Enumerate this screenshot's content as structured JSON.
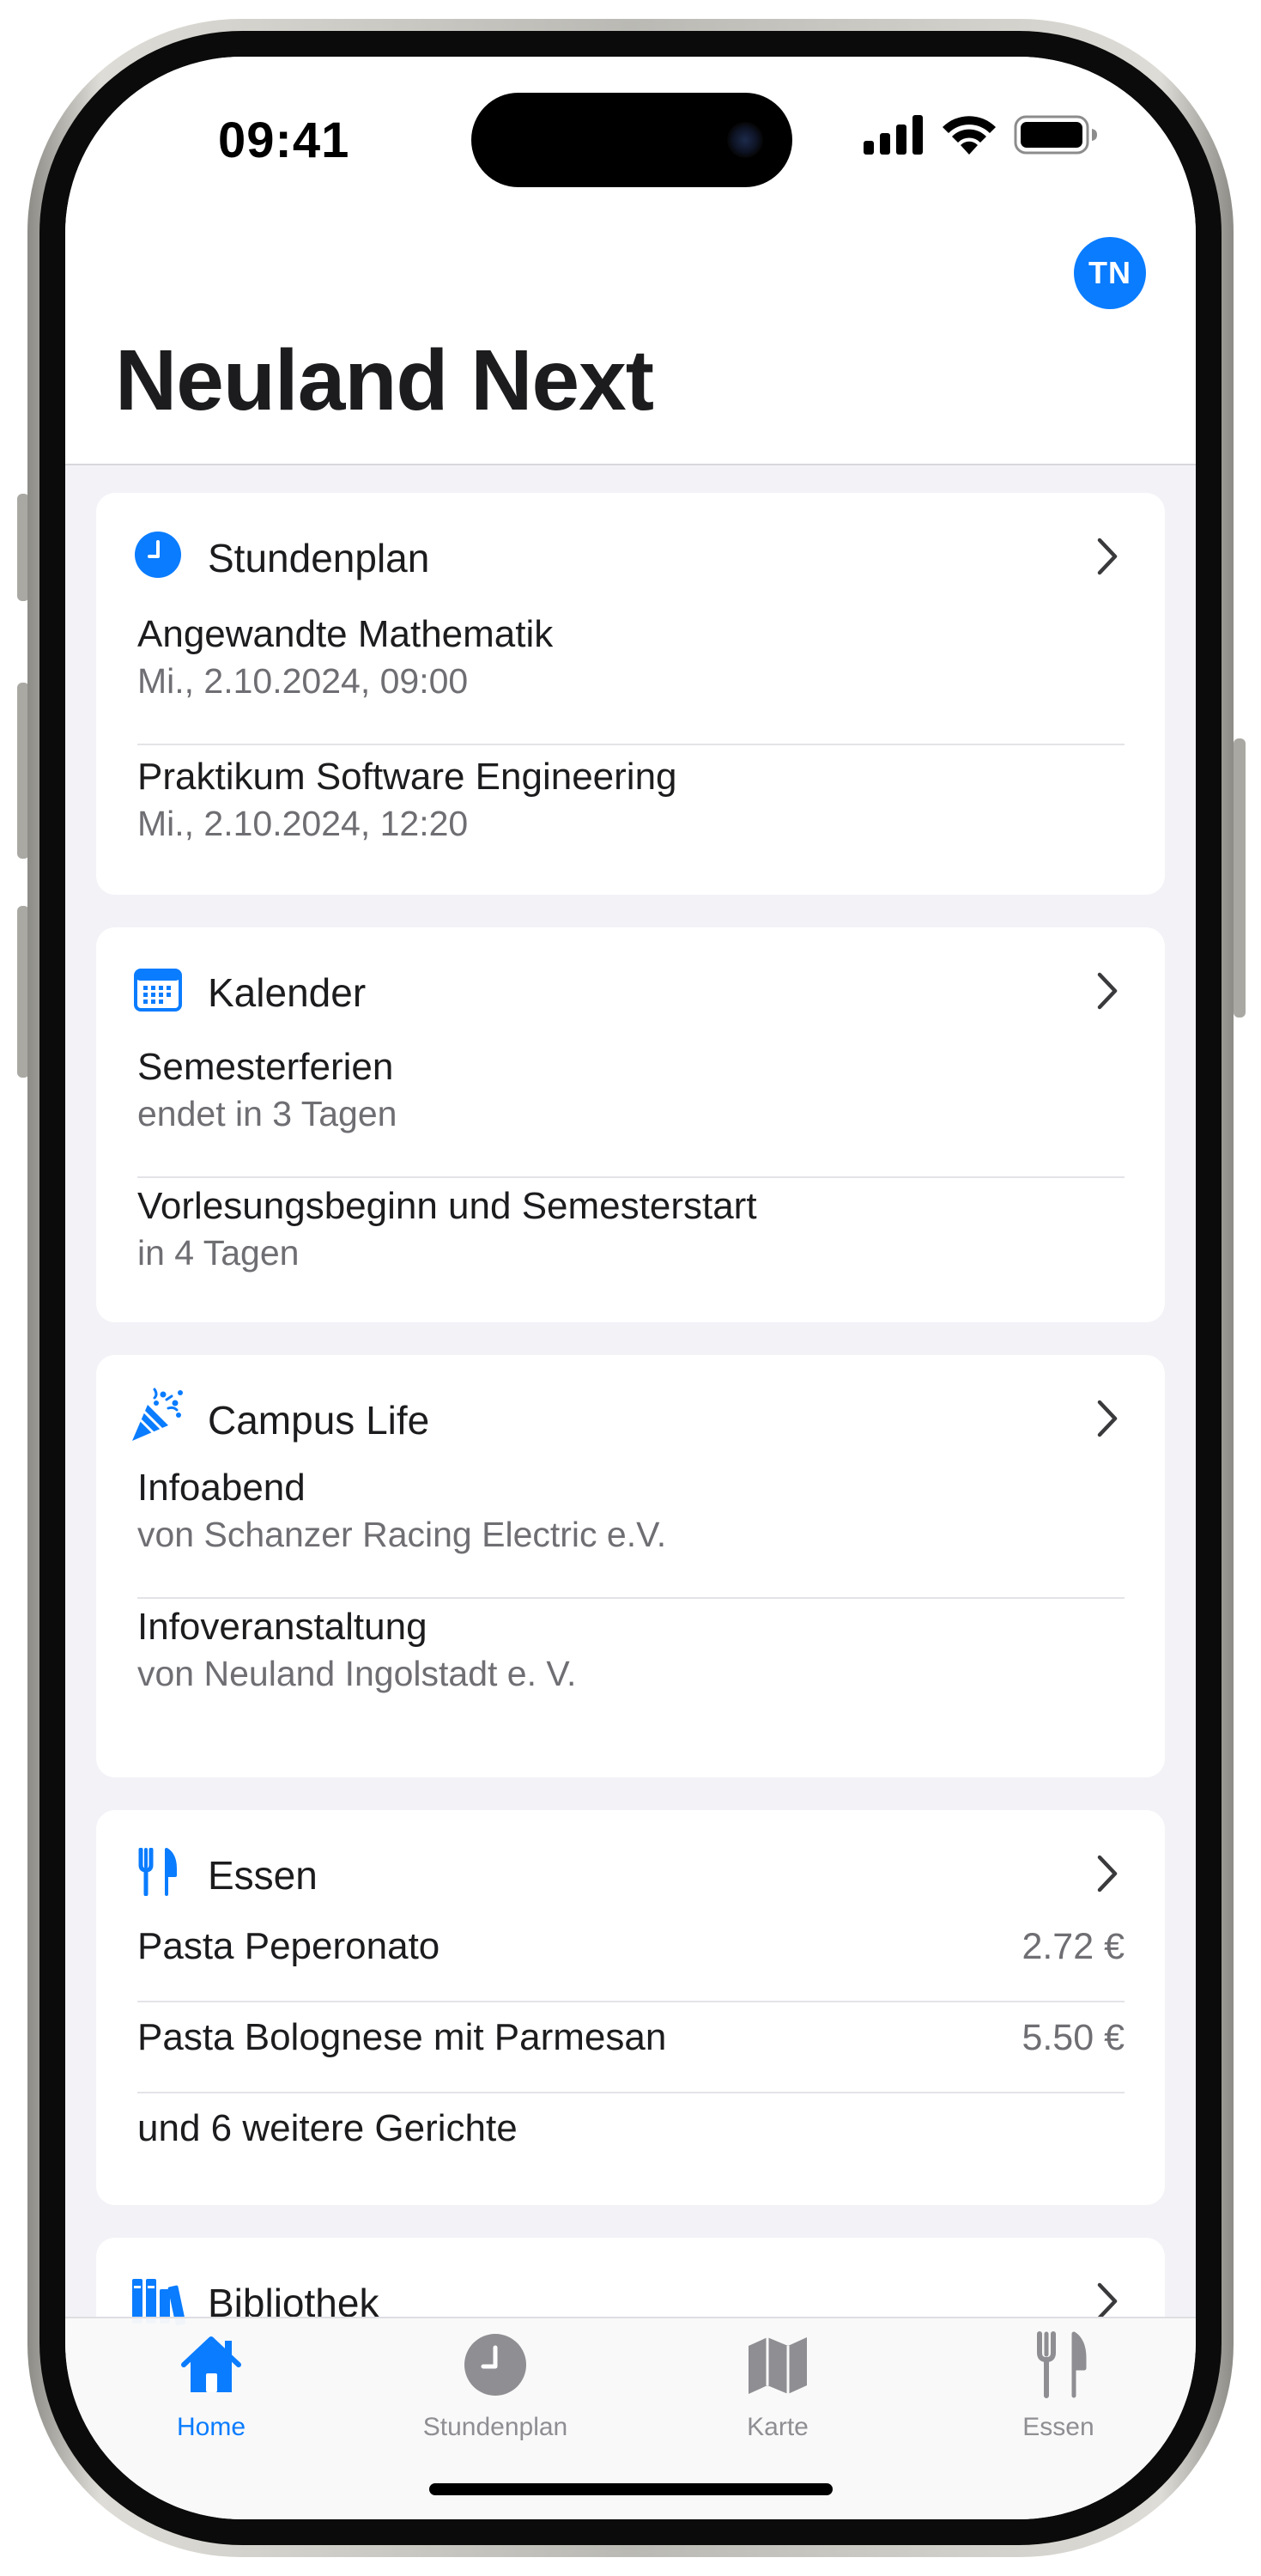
{
  "status_bar": {
    "time": "09:41",
    "icons": [
      "cellular-signal-icon",
      "wifi-icon",
      "battery-icon"
    ]
  },
  "header": {
    "avatar_initials": "TN",
    "title": "Neuland Next"
  },
  "colors": {
    "accent": "#0a7cff",
    "text_primary": "#1c1c1e",
    "text_secondary": "#6e6e73",
    "background": "#f2f2f7"
  },
  "cards": {
    "timetable": {
      "icon": "clock-icon",
      "title": "Stundenplan",
      "items": [
        {
          "title": "Angewandte Mathematik",
          "subtitle": "Mi., 2.10.2024, 09:00"
        },
        {
          "title": "Praktikum Software Engineering",
          "subtitle": "Mi., 2.10.2024, 12:20"
        }
      ]
    },
    "calendar": {
      "icon": "calendar-icon",
      "title": "Kalender",
      "items": [
        {
          "title": "Semesterferien",
          "subtitle": "endet in 3 Tagen"
        },
        {
          "title": "Vorlesungsbeginn und Semesterstart",
          "subtitle": "in 4 Tagen"
        }
      ]
    },
    "campus_life": {
      "icon": "party-popper-icon",
      "title": "Campus Life",
      "items": [
        {
          "title": "Infoabend",
          "subtitle": "von Schanzer Racing Electric e.V."
        },
        {
          "title": "Infoveranstaltung",
          "subtitle": "von Neuland Ingolstadt e. V."
        }
      ]
    },
    "food": {
      "icon": "fork-knife-icon",
      "title": "Essen",
      "items": [
        {
          "title": "Pasta Peperonato",
          "price": "2.72 €"
        },
        {
          "title": "Pasta Bolognese mit Parmesan",
          "price": "5.50 €"
        }
      ],
      "more": "und 6 weitere Gerichte"
    },
    "library": {
      "icon": "books-icon",
      "title": "Bibliothek"
    }
  },
  "tab_bar": {
    "active": "home",
    "tabs": [
      {
        "id": "home",
        "label": "Home",
        "icon": "house-icon"
      },
      {
        "id": "timetable",
        "label": "Stundenplan",
        "icon": "clock-icon"
      },
      {
        "id": "map",
        "label": "Karte",
        "icon": "map-icon"
      },
      {
        "id": "food",
        "label": "Essen",
        "icon": "fork-knife-icon"
      }
    ]
  }
}
